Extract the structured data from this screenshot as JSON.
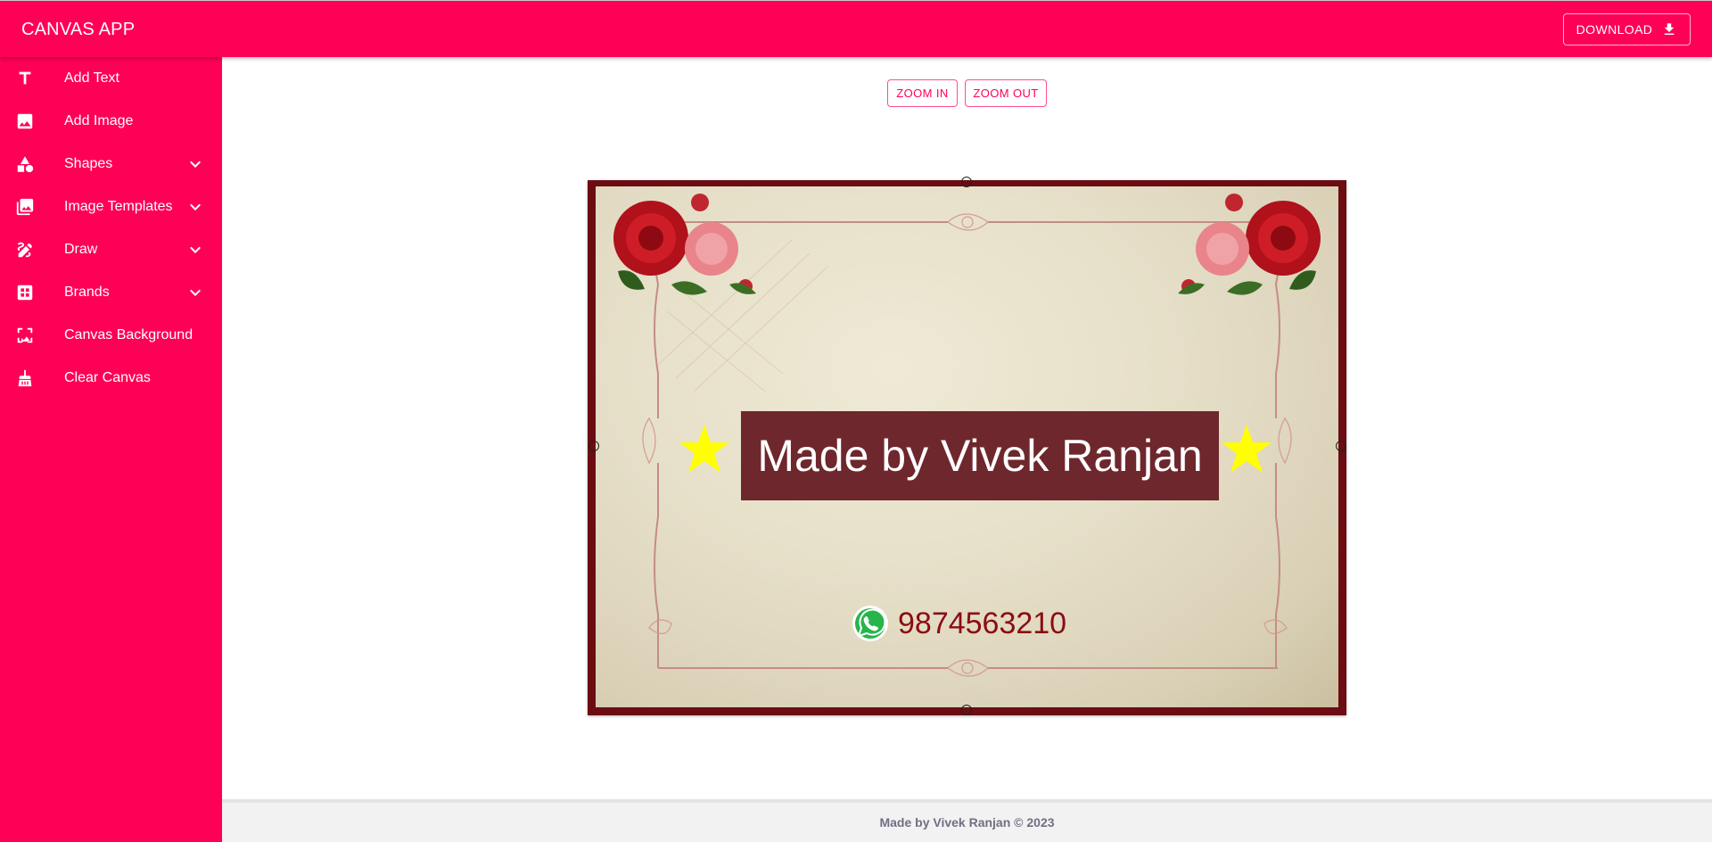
{
  "app": {
    "title": "CANVAS APP",
    "download_label": "DOWNLOAD"
  },
  "colors": {
    "brand": "#ff0057",
    "card_text_bg": "#6e272d",
    "phone": "#8a0d13",
    "star": "#ffff00"
  },
  "sidebar": {
    "items": [
      {
        "label": "Add Text",
        "icon": "text-icon",
        "expandable": false
      },
      {
        "label": "Add Image",
        "icon": "image-icon",
        "expandable": false
      },
      {
        "label": "Shapes",
        "icon": "shapes-icon",
        "expandable": true
      },
      {
        "label": "Image Templates",
        "icon": "photo-library-icon",
        "expandable": true
      },
      {
        "label": "Draw",
        "icon": "draw-icon",
        "expandable": true
      },
      {
        "label": "Brands",
        "icon": "brands-icon",
        "expandable": true
      },
      {
        "label": "Canvas Background",
        "icon": "background-icon",
        "expandable": false
      },
      {
        "label": "Clear Canvas",
        "icon": "broom-icon",
        "expandable": false
      }
    ]
  },
  "toolbar": {
    "zoom_in": "ZOOM IN",
    "zoom_out": "ZOOM OUT"
  },
  "canvas": {
    "title_text": "Made by Vivek Ranjan",
    "phone_number": "9874563210",
    "phone_icon": "whatsapp-icon",
    "decorations": [
      "roses-top-left",
      "roses-top-right",
      "star-left",
      "star-right",
      "ornamental-border"
    ]
  },
  "footer": {
    "text": "Made by Vivek Ranjan © 2023"
  }
}
